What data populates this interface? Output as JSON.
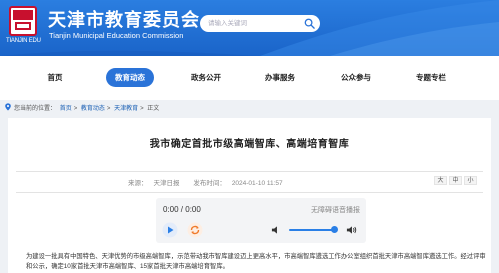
{
  "header": {
    "logo_text": "TIANJIN EDU",
    "site_title": "天津市教育委员会",
    "site_subtitle": "Tianjin Municipal Education Commission",
    "search_placeholder": "请输入关键词"
  },
  "nav": {
    "items": [
      {
        "label": "首页"
      },
      {
        "label": "教育动态"
      },
      {
        "label": "政务公开"
      },
      {
        "label": "办事服务"
      },
      {
        "label": "公众参与"
      },
      {
        "label": "专题专栏"
      }
    ],
    "active_index": 1
  },
  "breadcrumb": {
    "prefix": "您当前的位置：",
    "items": [
      "首页",
      "教育动态",
      "天津教育",
      "正文"
    ],
    "separator": ">"
  },
  "article": {
    "title": "我市确定首批市级高端智库、高端培育智库",
    "source_label": "来源：",
    "source": "天津日报",
    "time_label": "发布时间：",
    "time": "2024-01-10 11:57",
    "font_sizes": [
      "大",
      "中",
      "小"
    ],
    "player": {
      "time": "0:00 / 0:00",
      "note": "无障碍语音播报",
      "volume": 0.85
    },
    "body": "为建设一批具有中国特色、天津优势的市级高端智库，示范带动我市智库建设迈上更高水平，市高端智库遴选工作办公室组织首批天津市高端智库遴选工作。经过评审和公示，确定10家首批天津市高端智库、15家首批天津市高端培育智库。"
  }
}
